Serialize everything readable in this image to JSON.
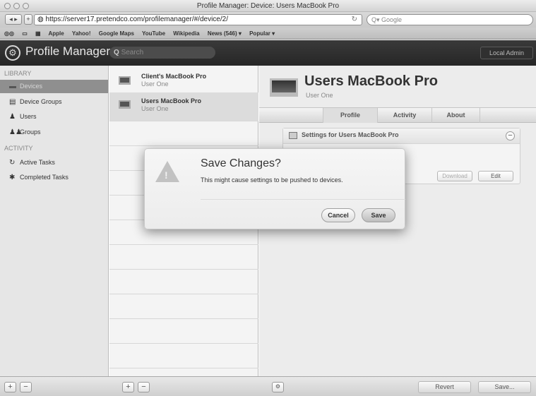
{
  "browser": {
    "window_title": "Profile Manager: Device: Users MacBook Pro",
    "url": "https://server17.pretendco.com/profilemanager/#/device/2/",
    "search_placeholder": "Google",
    "bookmarks": [
      "Apple",
      "Yahoo!",
      "Google Maps",
      "YouTube",
      "Wikipedia",
      "News (546) ▾",
      "Popular ▾"
    ]
  },
  "app": {
    "title": "Profile Manager",
    "search_placeholder": "Search",
    "admin_label": "Local Admin"
  },
  "sidebar": {
    "library_header": "LIBRARY",
    "library_items": [
      {
        "label": "Devices",
        "selected": true
      },
      {
        "label": "Device Groups"
      },
      {
        "label": "Users"
      },
      {
        "label": "Groups"
      }
    ],
    "activity_header": "ACTIVITY",
    "activity_items": [
      {
        "label": "Active Tasks"
      },
      {
        "label": "Completed Tasks"
      }
    ]
  },
  "devices": [
    {
      "name": "Client's MacBook Pro",
      "user": "User One"
    },
    {
      "name": "Users MacBook Pro",
      "user": "User One",
      "selected": true
    }
  ],
  "detail": {
    "title": "Users MacBook Pro",
    "subtitle": "User One",
    "tabs": [
      "Profile",
      "Activity",
      "About"
    ],
    "selected_tab": "Profile",
    "settings_title": "Settings for Users MacBook Pro",
    "download_label": "Download",
    "edit_label": "Edit"
  },
  "footer": {
    "revert_label": "Revert",
    "save_label": "Save..."
  },
  "dialog": {
    "title": "Save Changes?",
    "message": "This might cause settings to be pushed to devices.",
    "cancel_label": "Cancel",
    "save_label": "Save"
  }
}
